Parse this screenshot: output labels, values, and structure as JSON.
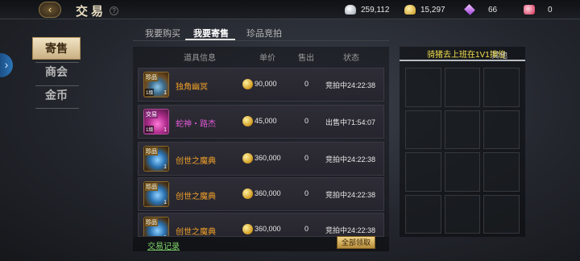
{
  "header": {
    "title": "交易",
    "help": "?",
    "currencies": [
      {
        "icon": "silver-coin-icon",
        "value": "259,112"
      },
      {
        "icon": "gold-coin-icon",
        "value": "15,297"
      },
      {
        "icon": "purple-gem-icon",
        "value": "66"
      },
      {
        "icon": "red-ticket-icon",
        "value": "0"
      }
    ]
  },
  "sidebar": {
    "items": [
      {
        "label": "寄售",
        "active": true
      },
      {
        "label": "商会",
        "active": false
      },
      {
        "label": "金币",
        "active": false
      }
    ]
  },
  "tabs": [
    {
      "label": "我要购买",
      "active": false
    },
    {
      "label": "我要寄售",
      "active": true
    },
    {
      "label": "珍品竞拍",
      "active": false
    }
  ],
  "table": {
    "columns": [
      "道具信息",
      "单价",
      "售出",
      "状态"
    ],
    "rows": [
      {
        "tag": "珍品",
        "level": "1级",
        "count": "1",
        "name": "独角幽冥",
        "name_color": "#f0a02a",
        "price": "90,000",
        "sold": "0",
        "status": "竞拍中24:22:38"
      },
      {
        "tag": "交易",
        "level": "1级",
        "count": "1",
        "name": "蛇神・路杰",
        "name_color": "#e25ad8",
        "price": "45,000",
        "sold": "0",
        "status": "出售中71:54:07"
      },
      {
        "tag": "珍品",
        "level": "",
        "count": "1",
        "name": "创世之魔典",
        "name_color": "#f0a02a",
        "price": "360,000",
        "sold": "0",
        "status": "竞拍中24:22:38"
      },
      {
        "tag": "珍品",
        "level": "",
        "count": "1",
        "name": "创世之魔典",
        "name_color": "#f0a02a",
        "price": "360,000",
        "sold": "0",
        "status": "竞拍中24:22:38"
      },
      {
        "tag": "珍品",
        "level": "",
        "count": "1",
        "name": "创世之魔典",
        "name_color": "#f0a02a",
        "price": "360,000",
        "sold": "0",
        "status": "竞拍中24:22:38"
      }
    ]
  },
  "footer": {
    "record_link": "交易记录",
    "collect_all": "全部领取"
  },
  "right_panel": {
    "marquee": "骑猪去上班在1V1排位",
    "category": "其他"
  }
}
